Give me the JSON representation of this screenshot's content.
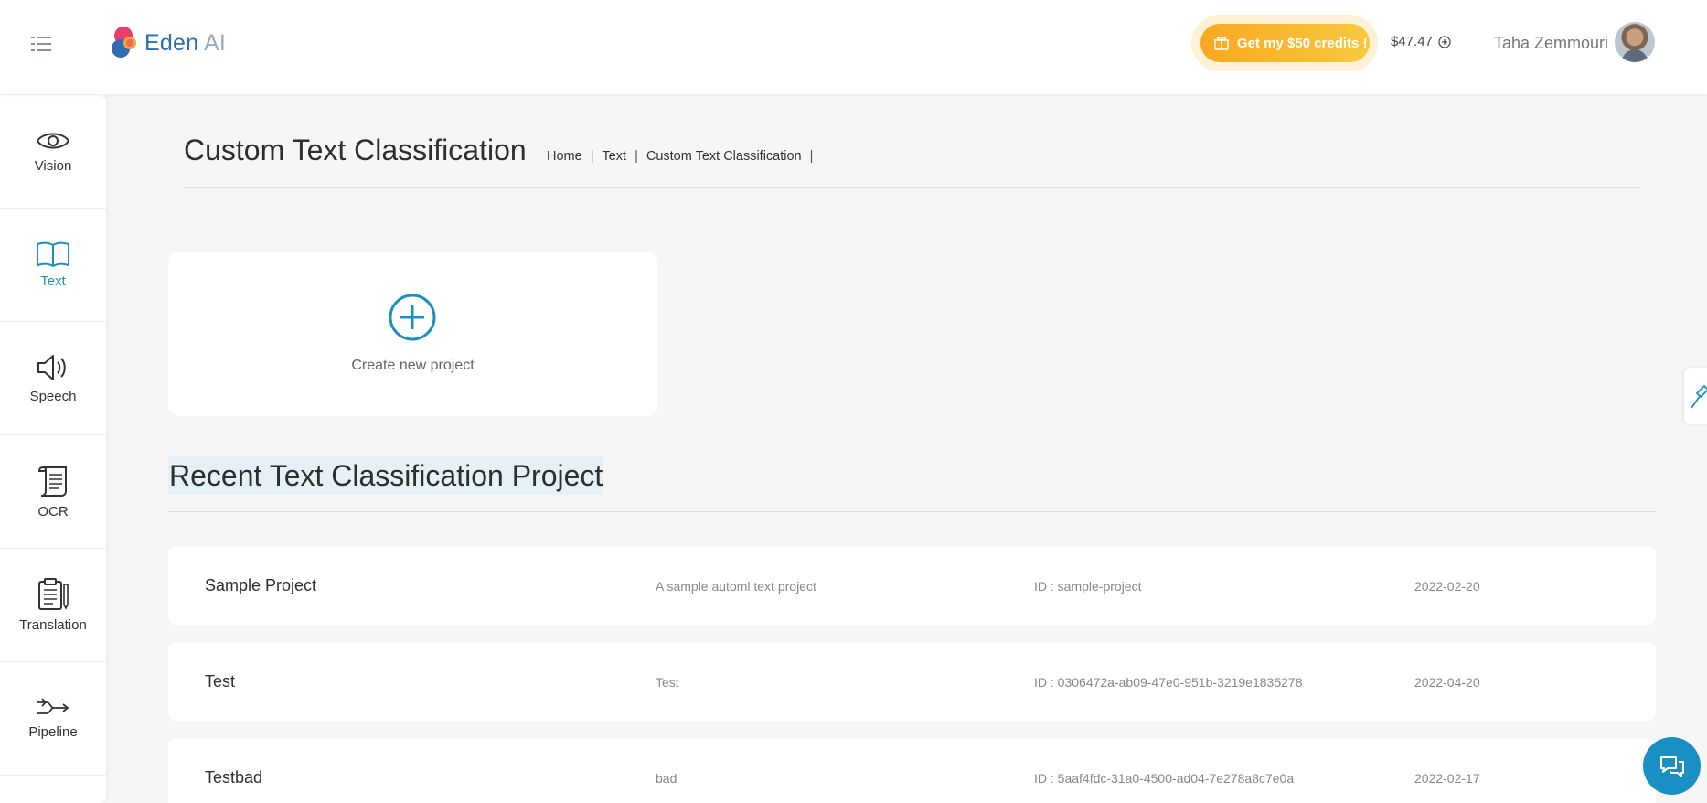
{
  "header": {
    "logo_text": "Eden",
    "logo_suffix": "AI",
    "credits_button": "Get my $50 credits !",
    "balance": "$47.47",
    "user_name": "Taha Zemmouri"
  },
  "sidebar": {
    "items": [
      {
        "label": "Vision",
        "icon": "eye-icon"
      },
      {
        "label": "Text",
        "icon": "book-icon",
        "active": true
      },
      {
        "label": "Speech",
        "icon": "speaker-icon"
      },
      {
        "label": "OCR",
        "icon": "scroll-icon"
      },
      {
        "label": "Translation",
        "icon": "clipboard-icon"
      },
      {
        "label": "Pipeline",
        "icon": "pipeline-icon"
      }
    ]
  },
  "main": {
    "title": "Custom Text Classification",
    "breadcrumb": [
      "Home",
      "Text",
      "Custom Text Classification"
    ],
    "create_label": "Create new project",
    "recent_title": "Recent Text Classification Project",
    "projects": [
      {
        "name": "Sample Project",
        "description": "A sample automl text project",
        "id": "ID : sample-project",
        "date": "2022-02-20"
      },
      {
        "name": "Test",
        "description": "Test",
        "id": "ID : 0306472a-ab09-47e0-951b-3219e1835278",
        "date": "2022-04-20"
      },
      {
        "name": "Testbad",
        "description": "bad",
        "id": "ID : 5aaf4fdc-31a0-4500-ad04-7e278a8c7e0a",
        "date": "2022-02-17"
      }
    ]
  },
  "colors": {
    "accent": "#1a8fc4",
    "credits_gradient_start": "#f7a820",
    "credits_gradient_end": "#f9c940",
    "highlight": "#e5f1f7"
  }
}
